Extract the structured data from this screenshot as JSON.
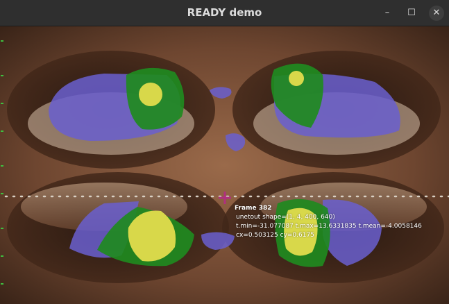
{
  "window": {
    "title": "READY demo",
    "controls": {
      "minimize": "–",
      "maximize": "☐",
      "close": "✕"
    }
  },
  "overlay": {
    "frame_label": "Frame 382",
    "shape_line": "unetout shape=(1, 4, 400, 640)",
    "stats_line": "t.min=-31.077087 t.max=13.6331835 t.mean=-4.0058146",
    "center_line": "cx=0.503125 cy=0.6175"
  },
  "colors": {
    "segment_purple": "#6a5fcf",
    "segment_green": "#1f8a1f",
    "segment_yellow": "#d8d84a",
    "crosshair": "#b0307f",
    "guide_dots": "#d9d0c4"
  }
}
